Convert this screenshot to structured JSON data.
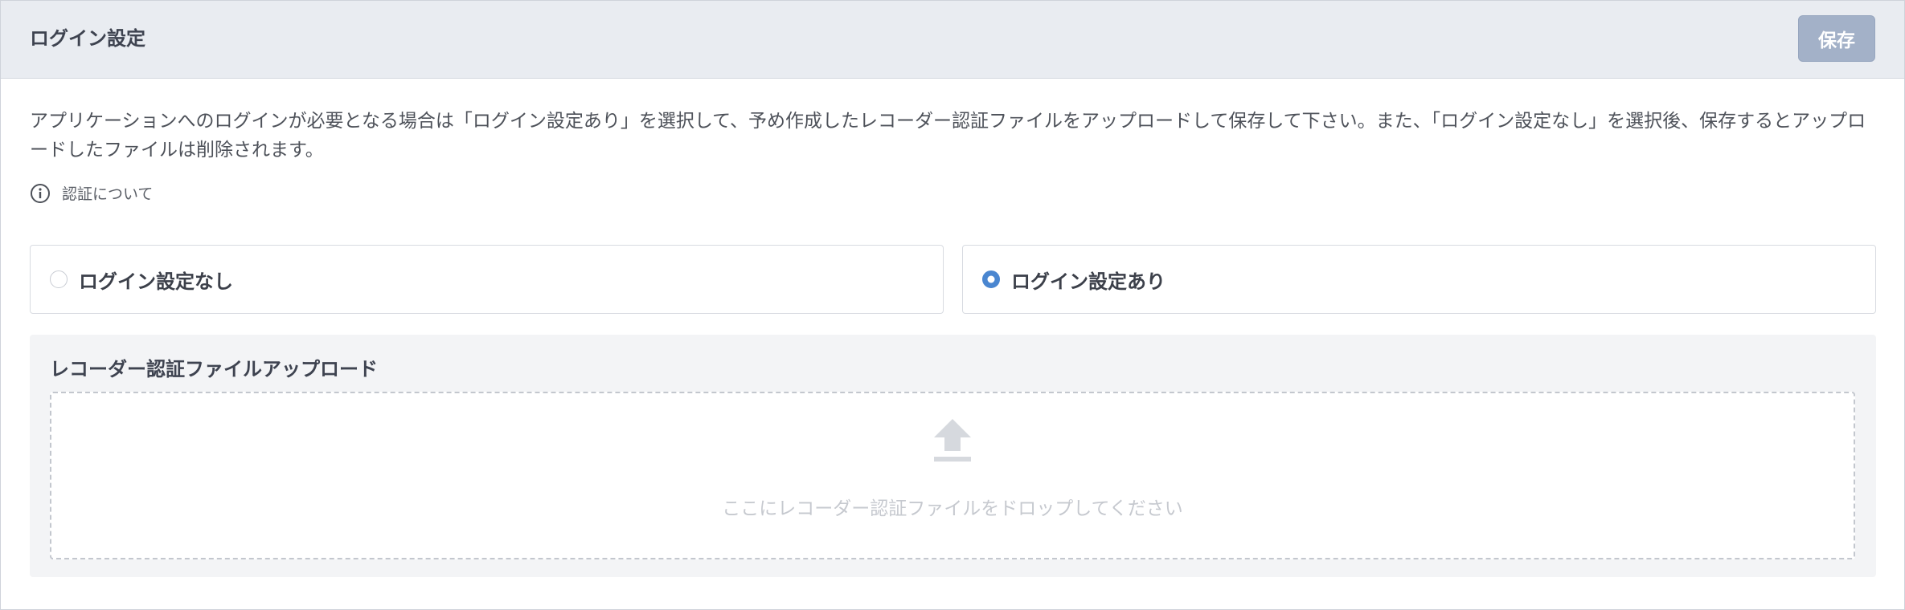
{
  "header": {
    "title": "ログイン設定",
    "save_label": "保存"
  },
  "description": "アプリケーションへのログインが必要となる場合は「ログイン設定あり」を選択して、予め作成したレコーダー認証ファイルをアップロードして保存して下さい。また、「ログイン設定なし」を選択後、保存するとアップロードしたファイルは削除されます。",
  "info": {
    "icon": "info-icon",
    "link_text": "認証について"
  },
  "options": [
    {
      "label": "ログイン設定なし",
      "selected": false
    },
    {
      "label": "ログイン設定あり",
      "selected": true
    }
  ],
  "upload": {
    "title": "レコーダー認証ファイルアップロード",
    "icon": "upload-icon",
    "dropzone_text": "ここにレコーダー認証ファイルをドロップしてください"
  },
  "colors": {
    "header_bg": "#e9ecf1",
    "save_button": "#a3b1c8",
    "radio_selected": "#4a86d0",
    "upload_bg": "#f3f4f6"
  }
}
